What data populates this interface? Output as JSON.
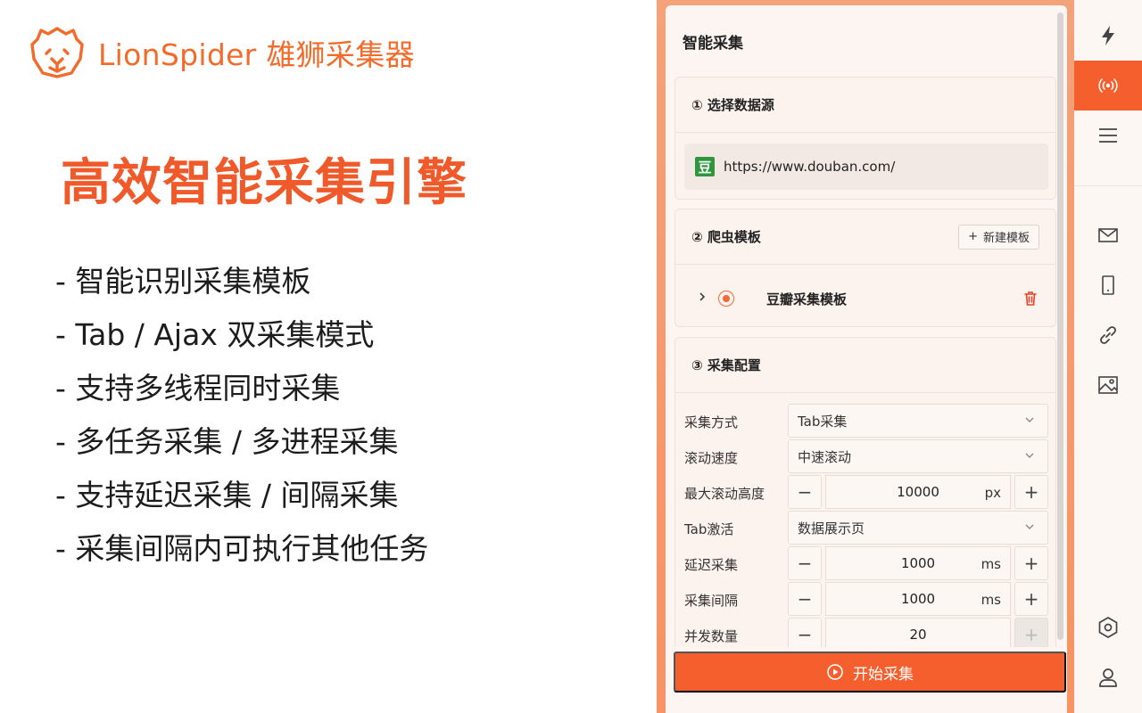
{
  "brand": {
    "name": "LionSpider 雄狮采集器",
    "logo_icon": "lion-head-icon",
    "accent": "#f26b2a"
  },
  "headline": "高效智能采集引擎",
  "features": [
    "- 智能识别采集模板",
    "- Tab / Ajax 双采集模式",
    "- 支持多线程同时采集",
    "- 多任务采集 / 多进程采集",
    "- 支持延迟采集 / 间隔采集",
    "- 采集间隔内可执行其他任务"
  ],
  "panel": {
    "title": "智能采集",
    "source": {
      "title": "① 选择数据源",
      "favicon_text": "豆",
      "url": "https://www.douban.com/"
    },
    "template": {
      "title": "② 爬虫模板",
      "new_label": "新建模板",
      "items": [
        {
          "name": "豆瓣采集模板"
        }
      ]
    },
    "config": {
      "title": "③ 采集配置",
      "mode": {
        "label": "采集方式",
        "value": "Tab采集"
      },
      "scroll_speed": {
        "label": "滚动速度",
        "value": "中速滚动"
      },
      "max_scroll": {
        "label": "最大滚动高度",
        "value": "10000",
        "unit": "px"
      },
      "tab_activate": {
        "label": "Tab激活",
        "value": "数据展示页"
      },
      "delay": {
        "label": "延迟采集",
        "value": "1000",
        "unit": "ms"
      },
      "interval": {
        "label": "采集间隔",
        "value": "1000",
        "unit": "ms"
      },
      "concurrency": {
        "label": "并发数量",
        "value": "20"
      }
    },
    "start_label": "开始采集"
  },
  "sidebar": [
    "flash-icon",
    "broadcast-icon",
    "menu-icon",
    "mail-icon",
    "phone-icon",
    "link-icon",
    "image-icon",
    "settings-icon",
    "user-icon"
  ]
}
